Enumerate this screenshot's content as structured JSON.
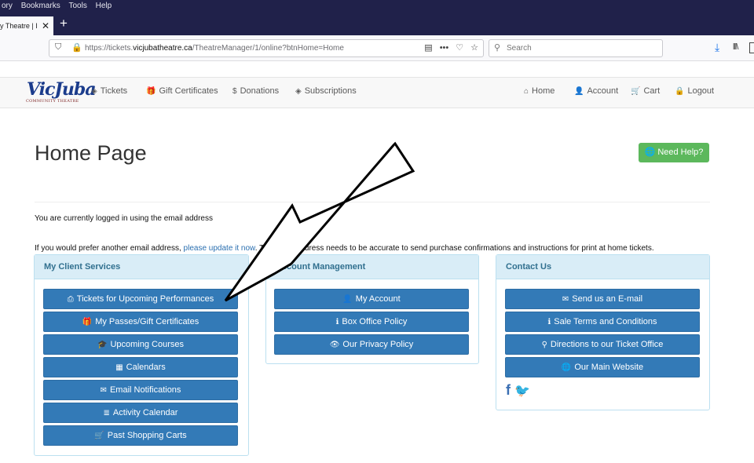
{
  "browser": {
    "menu": [
      "ory",
      "Bookmarks",
      "Tools",
      "Help"
    ],
    "tab_title": "y Theatre | I",
    "url_prefix": "https://tickets.",
    "url_domain": "vicjubatheatre.ca",
    "url_path": "/TheatreManager/1/online?btnHome=Home",
    "search_placeholder": "Search"
  },
  "site": {
    "logo_main": "VicJuba",
    "logo_sub": "COMMUNITY THEATRE",
    "nav_left": [
      {
        "icon": "tag-icon",
        "glyph": "◈",
        "label": "Tickets"
      },
      {
        "icon": "gift-icon",
        "glyph": "🎁",
        "label": "Gift Certificates"
      },
      {
        "icon": "dollar-icon",
        "glyph": "$",
        "label": "Donations"
      },
      {
        "icon": "tag-icon",
        "glyph": "◈",
        "label": "Subscriptions"
      }
    ],
    "nav_right": [
      {
        "icon": "home-icon",
        "glyph": "⌂",
        "label": "Home"
      },
      {
        "icon": "user-icon",
        "glyph": "👤",
        "label": "Account"
      },
      {
        "icon": "cart-icon",
        "glyph": "🛒",
        "label": "Cart"
      },
      {
        "icon": "lock-icon",
        "glyph": "🔒",
        "label": "Logout"
      }
    ]
  },
  "page": {
    "title": "Home Page",
    "help_label": "Need Help?",
    "logged_in_text": "You are currently logged in using the email address",
    "prefer_text_1": "If you would prefer another email address, ",
    "prefer_link": "please update it now",
    "prefer_text_2": ". The email address needs to be accurate to send purchase confirmations and instructions for print at home tickets."
  },
  "panels": {
    "client": {
      "title": "My Client Services",
      "buttons": [
        {
          "icon": "print-icon",
          "glyph": "⎙",
          "label": "Tickets for Upcoming Performances"
        },
        {
          "icon": "gift-icon",
          "glyph": "🎁",
          "label": "My Passes/Gift Certificates"
        },
        {
          "icon": "graduation-cap-icon",
          "glyph": "🎓",
          "label": "Upcoming Courses"
        },
        {
          "icon": "calendar-icon",
          "glyph": "▦",
          "label": "Calendars"
        },
        {
          "icon": "envelope-icon",
          "glyph": "✉",
          "label": "Email Notifications"
        },
        {
          "icon": "list-icon",
          "glyph": "≣",
          "label": "Activity Calendar"
        },
        {
          "icon": "cart-icon",
          "glyph": "🛒",
          "label": "Past Shopping Carts"
        }
      ]
    },
    "account": {
      "title": "Account Management",
      "buttons": [
        {
          "icon": "user-icon",
          "glyph": "👤",
          "label": "My Account"
        },
        {
          "icon": "info-icon",
          "glyph": "ℹ",
          "label": "Box Office Policy"
        },
        {
          "icon": "eye-icon",
          "glyph": "👁",
          "label": "Our Privacy Policy"
        }
      ]
    },
    "contact": {
      "title": "Contact Us",
      "buttons": [
        {
          "icon": "envelope-icon",
          "glyph": "✉",
          "label": "Send us an E-mail"
        },
        {
          "icon": "info-icon",
          "glyph": "ℹ",
          "label": "Sale Terms and Conditions"
        },
        {
          "icon": "map-marker-icon",
          "glyph": "⚲",
          "label": "Directions to our Ticket Office"
        },
        {
          "icon": "globe-icon",
          "glyph": "🌐",
          "label": "Our Main Website"
        }
      ]
    }
  },
  "colors": {
    "primary": "#337ab7",
    "success": "#5cb85c",
    "panel_head": "#d9edf7",
    "panel_text": "#31708f"
  }
}
